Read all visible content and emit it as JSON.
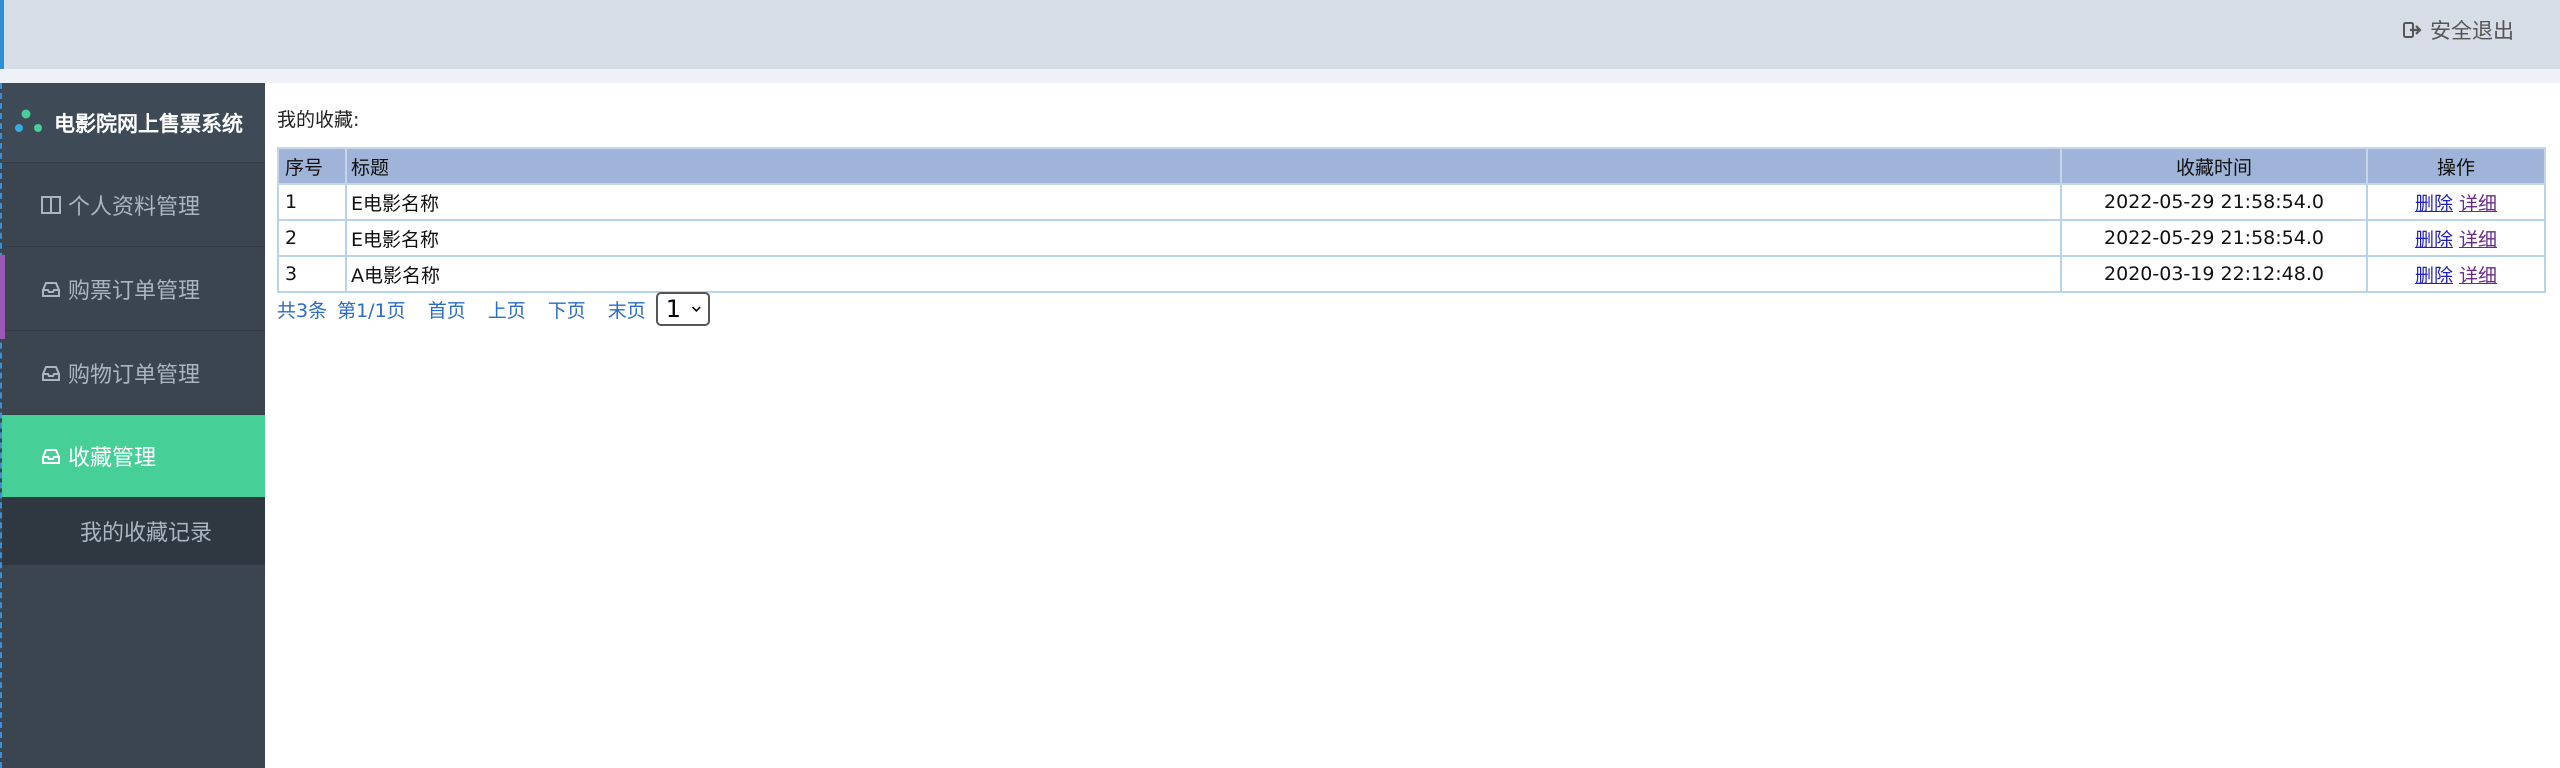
{
  "header": {
    "logout_label": "安全退出"
  },
  "sidebar": {
    "brand": "电影院网上售票系统",
    "items": [
      {
        "label": "个人资料管理"
      },
      {
        "label": "购票订单管理"
      },
      {
        "label": "购物订单管理"
      },
      {
        "label": "收藏管理"
      }
    ],
    "subitem": "我的收藏记录"
  },
  "main": {
    "title": "我的收藏:",
    "columns": [
      "序号",
      "标题",
      "收藏时间",
      "操作"
    ],
    "rows": [
      {
        "no": "1",
        "title": "E电影名称",
        "time": "2022-05-29 21:58:54.0",
        "delete": "删除",
        "detail": "详细"
      },
      {
        "no": "2",
        "title": "E电影名称",
        "time": "2022-05-29 21:58:54.0",
        "delete": "删除",
        "detail": "详细"
      },
      {
        "no": "3",
        "title": "A电影名称",
        "time": "2020-03-19 22:12:48.0",
        "delete": "删除",
        "detail": "详细"
      }
    ],
    "pager": {
      "total": "共3条",
      "page_info": "第1/1页",
      "first": "首页",
      "prev": "上页",
      "next": "下页",
      "last": "末页",
      "selected_page": "1"
    }
  },
  "colors": {
    "sidebar_bg": "#3a4550",
    "active_item": "#47cf98",
    "table_header": "#9fb4d8",
    "topbar_bg": "#d6dde6"
  }
}
